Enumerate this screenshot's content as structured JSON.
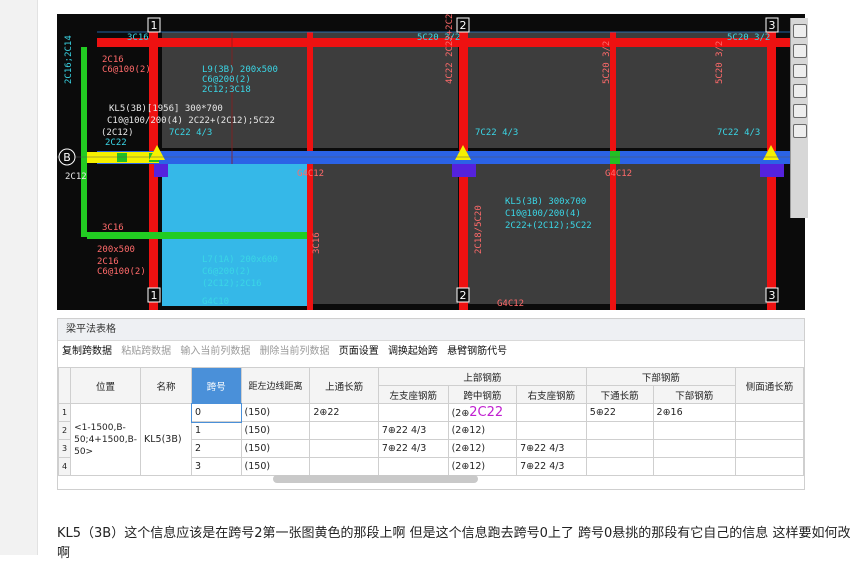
{
  "cad": {
    "axis_top": [
      "1",
      "2",
      "3"
    ],
    "axis_bottom": [
      "1",
      "2",
      "3"
    ],
    "axis_left": "B",
    "labels": [
      {
        "text": "3C16",
        "cls": "g"
      },
      {
        "text": "5C20 3/2",
        "cls": "g"
      },
      {
        "text": "5C20 3/2",
        "cls": "g"
      },
      {
        "text": "2C16",
        "cls": "r"
      },
      {
        "text": "C6@100(2)",
        "cls": "r"
      },
      {
        "text": "L9(3B) 200x500",
        "cls": "g"
      },
      {
        "text": "C6@200(2)",
        "cls": "g"
      },
      {
        "text": "2C12;3C18",
        "cls": "g"
      },
      {
        "text": "2C16;2C14",
        "cls": "g"
      },
      {
        "text": "KL5(3B)[1956] 300*700",
        "cls": "w"
      },
      {
        "text": "C10@100/200(4) 2C22+(2C12);5C22",
        "cls": "w"
      },
      {
        "text": "(2C12)",
        "cls": "w"
      },
      {
        "text": "7C22 4/3",
        "cls": "g"
      },
      {
        "text": "2C22",
        "cls": "g"
      },
      {
        "text": "4C22 2C22+2C20",
        "cls": "r"
      },
      {
        "text": "5C20 3/2",
        "cls": "r"
      },
      {
        "text": "7C22 4/3",
        "cls": "g"
      },
      {
        "text": "5C20 3/2",
        "cls": "r"
      },
      {
        "text": "7C22 4/3",
        "cls": "g"
      },
      {
        "text": "2C12",
        "cls": "w"
      },
      {
        "text": "G4C12",
        "cls": "r"
      },
      {
        "text": "G4C12",
        "cls": "r"
      },
      {
        "text": "KL5(3B) 300x700",
        "cls": "g"
      },
      {
        "text": "C10@100/200(4)",
        "cls": "g"
      },
      {
        "text": "2C22+(2C12);5C22",
        "cls": "g"
      },
      {
        "text": "3C16",
        "cls": "r"
      },
      {
        "text": "200x500",
        "cls": "r"
      },
      {
        "text": "2C16",
        "cls": "r"
      },
      {
        "text": "C6@100(2)",
        "cls": "r"
      },
      {
        "text": "L7(1A) 200x600",
        "cls": "g"
      },
      {
        "text": "C6@200(2)",
        "cls": "g"
      },
      {
        "text": "(2C12);2C16",
        "cls": "g"
      },
      {
        "text": "G4C10",
        "cls": "g"
      },
      {
        "text": "3C16",
        "cls": "r"
      },
      {
        "text": "2C18/5C20",
        "cls": "r"
      },
      {
        "text": "G4C12",
        "cls": "r"
      }
    ]
  },
  "panel": {
    "title": "梁平法表格",
    "toolbar": [
      {
        "label": "复制跨数据",
        "enabled": true
      },
      {
        "label": "粘贴跨数据",
        "enabled": false
      },
      {
        "label": "输入当前列数据",
        "enabled": false
      },
      {
        "label": "删除当前列数据",
        "enabled": false
      },
      {
        "label": "页面设置",
        "enabled": true
      },
      {
        "label": "调换起始跨",
        "enabled": true
      },
      {
        "label": "悬臂钢筋代号",
        "enabled": true
      }
    ]
  },
  "table": {
    "group_headers": {
      "upper": "上部钢筋",
      "lower": "下部钢筋"
    },
    "headers": {
      "position": "位置",
      "name": "名称",
      "span": "跨号",
      "dist": "距左边线距离",
      "upper_through": "上通长筋",
      "left_seat": "左支座钢筋",
      "mid": "跨中钢筋",
      "right_seat": "右支座钢筋",
      "lower_through": "下通长筋",
      "lower_bar": "下部钢筋",
      "side": "侧面通长筋"
    },
    "row_numbers": [
      "1",
      "2",
      "3",
      "4"
    ],
    "position_value": "<1-1500,B-50;4+1500,B-50>",
    "name_value": "KL5(3B)",
    "mid_hint": "2C22",
    "rows": [
      {
        "span": "0",
        "dist": "(150)",
        "upper_through": "2⊕22",
        "left_seat": "",
        "mid": "(2⊕",
        "right_seat": "",
        "lower_through": "5⊕22",
        "lower_bar": "2⊕16",
        "side": ""
      },
      {
        "span": "1",
        "dist": "(150)",
        "upper_through": "",
        "left_seat": "7⊕22 4/3",
        "mid": "(2⊕12)",
        "right_seat": "",
        "lower_through": "",
        "lower_bar": "",
        "side": ""
      },
      {
        "span": "2",
        "dist": "(150)",
        "upper_through": "",
        "left_seat": "7⊕22 4/3",
        "mid": "(2⊕12)",
        "right_seat": "7⊕22 4/3",
        "lower_through": "",
        "lower_bar": "",
        "side": ""
      },
      {
        "span": "3",
        "dist": "(150)",
        "upper_through": "",
        "left_seat": "",
        "mid": "(2⊕12)",
        "right_seat": "7⊕22 4/3",
        "lower_through": "",
        "lower_bar": "",
        "side": ""
      }
    ]
  },
  "question": "KL5（3B）这个信息应该是在跨号2第一张图黄色的那段上啊 但是这个信息跑去跨号0上了 跨号0悬挑的那段有它自己的信息 这样要如何改啊"
}
